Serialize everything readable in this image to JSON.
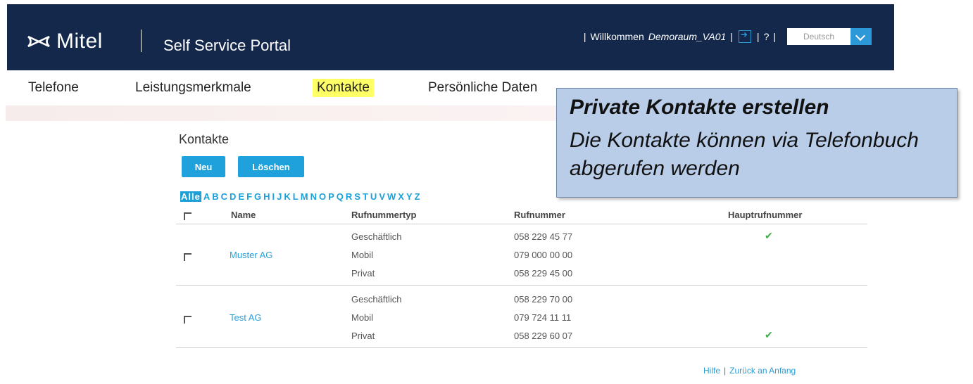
{
  "header": {
    "brand": "Mitel",
    "portal_title": "Self Service Portal",
    "welcome_label": "Willkommen",
    "user_name": "Demoraum_VA01",
    "help_label": "?",
    "language": "Deutsch"
  },
  "nav": {
    "items": [
      {
        "label": "Telefone"
      },
      {
        "label": "Leistungsmerkmale"
      },
      {
        "label": "Kontakte",
        "active": true
      },
      {
        "label": "Persönliche Daten"
      }
    ]
  },
  "callout": {
    "title": "Private Kontakte erstellen",
    "text": "Die Kontakte können via Telefonbuch abgerufen werden"
  },
  "page": {
    "title": "Kontakte",
    "new_button": "Neu",
    "delete_button": "Löschen"
  },
  "alphabet": {
    "all": "Alle",
    "letters": [
      "A",
      "B",
      "C",
      "D",
      "E",
      "F",
      "G",
      "H",
      "I",
      "J",
      "K",
      "L",
      "M",
      "N",
      "O",
      "P",
      "Q",
      "R",
      "S",
      "T",
      "U",
      "V",
      "W",
      "X",
      "Y",
      "Z"
    ]
  },
  "table": {
    "headers": {
      "name": "Name",
      "type": "Rufnummertyp",
      "number": "Rufnummer",
      "main": "Hauptrufnummer"
    },
    "contacts": [
      {
        "name": "Muster AG",
        "entries": [
          {
            "type": "Geschäftlich",
            "number": "058 229 45 77",
            "main": true
          },
          {
            "type": "Mobil",
            "number": "079 000 00 00",
            "main": false
          },
          {
            "type": "Privat",
            "number": "058 229 45 00",
            "main": false
          }
        ]
      },
      {
        "name": "Test AG",
        "entries": [
          {
            "type": "Geschäftlich",
            "number": "058 229 70 00",
            "main": false
          },
          {
            "type": "Mobil",
            "number": "079 724 11 11",
            "main": false
          },
          {
            "type": "Privat",
            "number": "058 229 60 07",
            "main": true
          }
        ]
      }
    ]
  },
  "footer": {
    "help": "Hilfe",
    "back": "Zurück an Anfang"
  },
  "colors": {
    "header_bg": "#14284b",
    "accent": "#1fa2dc",
    "nav_highlight": "#ffff66",
    "callout_bg": "#b9cde9",
    "check": "#3fae49"
  }
}
